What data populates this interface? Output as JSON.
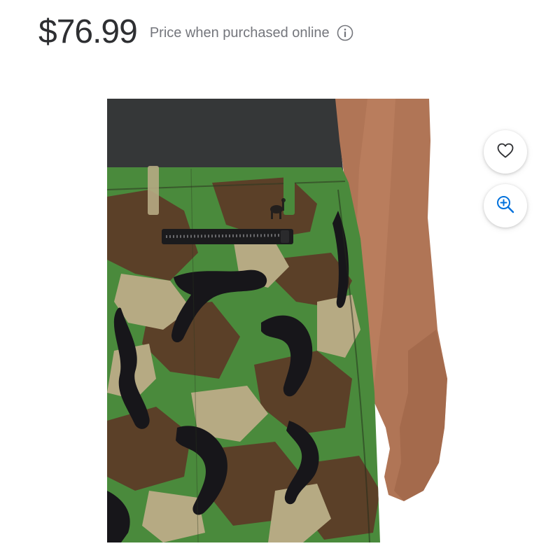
{
  "price": {
    "amount": "$76.99",
    "note": "Price when purchased online"
  },
  "icons": {
    "info": "info-icon",
    "favorite": "heart-icon",
    "zoom": "zoom-in-icon"
  },
  "colors": {
    "text": "#2e2f32",
    "muted": "#74767c",
    "accent": "#0071dc"
  }
}
